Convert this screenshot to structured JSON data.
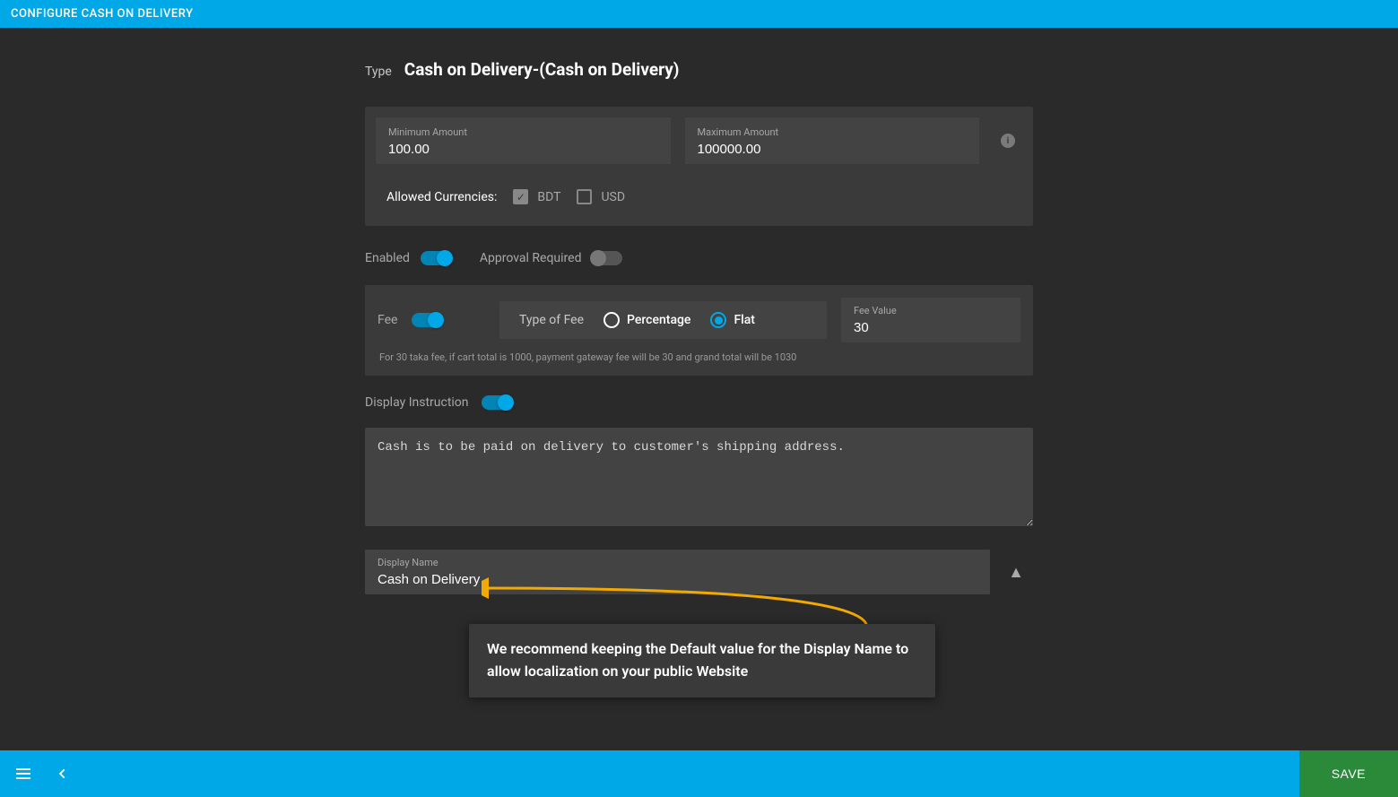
{
  "header": {
    "title": "CONFIGURE CASH ON DELIVERY"
  },
  "type": {
    "label": "Type",
    "value": "Cash on Delivery-(Cash on Delivery)"
  },
  "minAmount": {
    "label": "Minimum Amount",
    "value": "100.00"
  },
  "maxAmount": {
    "label": "Maximum Amount",
    "value": "100000.00"
  },
  "currencies": {
    "label": "Allowed Currencies:",
    "options": {
      "bdt": "BDT",
      "usd": "USD"
    }
  },
  "toggles": {
    "enabled_label": "Enabled",
    "approval_label": "Approval Required",
    "fee_label": "Fee",
    "display_instruction_label": "Display Instruction"
  },
  "feeType": {
    "label": "Type of Fee",
    "percentage": "Percentage",
    "flat": "Flat"
  },
  "feeValue": {
    "label": "Fee Value",
    "value": "30"
  },
  "feeHelp": "For 30 taka fee, if cart total is 1000, payment gateway fee will be 30 and grand total will be 1030",
  "instructionText": "Cash is to be paid on delivery to customer's shipping address.",
  "displayName": {
    "label": "Display Name",
    "value": "Cash on Delivery"
  },
  "tooltip": "We recommend keeping the Default value for the Display Name to allow localization on your public Website",
  "footer": {
    "save": "SAVE"
  }
}
